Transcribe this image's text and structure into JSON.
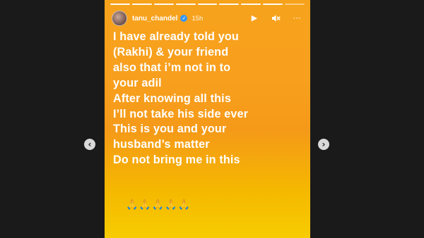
{
  "story": {
    "username": "tanu_chandel",
    "time_ago": "15h",
    "progress_segments": 9,
    "progress_current": 8,
    "lines": [
      "I have already told you",
      "(Rakhi) & your friend",
      "also that i’m not in to",
      "your adil",
      "After knowing all this",
      "I’ll not take his side ever",
      "This is you and your",
      "husband’s matter",
      "Do not bring me in this"
    ],
    "emojis": "🙏🙏🙏🙏🙏"
  },
  "controls": {
    "play_icon": "▶",
    "mute_icon": "🔇",
    "more_icon": "⋯"
  },
  "nav": {
    "prev_icon": "‹",
    "next_icon": "›"
  },
  "colors": {
    "gradient_top": "#f7a21b",
    "gradient_bottom": "#f7cc00",
    "verified_blue": "#3897f0",
    "page_background": "#1a1a1a"
  }
}
